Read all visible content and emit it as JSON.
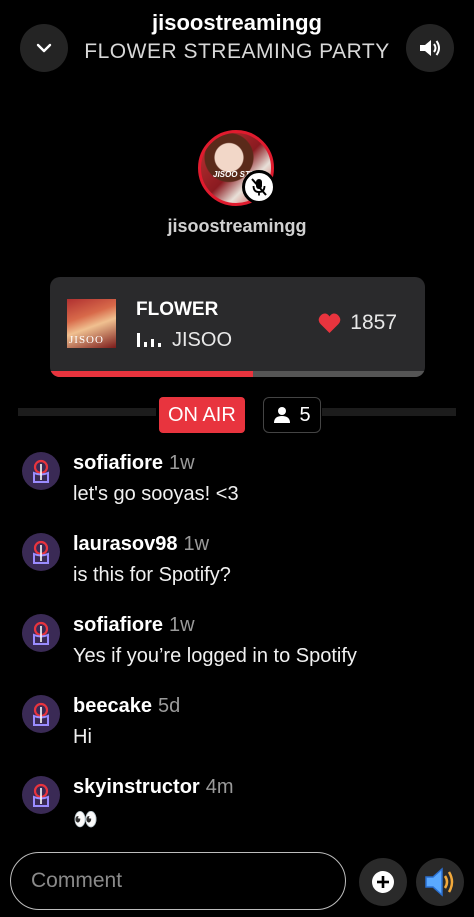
{
  "header": {
    "title": "jisoostreamingg",
    "subtitle": "FLOWER STREAMING PARTY"
  },
  "host": {
    "name": "jisoostreamingg",
    "avatar_text": "JISOO STREA"
  },
  "now_playing": {
    "album_art_text": "JISOO",
    "title": "FLOWER",
    "artist": "JISOO",
    "likes": "1857",
    "progress": 0.54
  },
  "status": {
    "on_air_label": "ON AIR",
    "listener_count": "5"
  },
  "comments": [
    {
      "user": "sofiafiore",
      "time": "1w",
      "text": "let's go sooyas! <3"
    },
    {
      "user": "laurasov98",
      "time": "1w",
      "text": "is this for Spotify?"
    },
    {
      "user": "sofiafiore",
      "time": "1w",
      "text": "Yes if you’re logged in to Spotify"
    },
    {
      "user": "beecake",
      "time": "5d",
      "text": "Hi"
    },
    {
      "user": "skyinstructor",
      "time": "4m",
      "text": "👀"
    }
  ],
  "composer": {
    "placeholder": "Comment"
  },
  "colors": {
    "accent": "#e8343e",
    "background": "#000000",
    "card": "#2a2a2c"
  },
  "icons": [
    "chevron-down-icon",
    "volume-icon",
    "mic-off-icon",
    "equalizer-icon",
    "heart-icon",
    "person-icon",
    "user-avatar-icon",
    "plus-icon",
    "speaker-icon"
  ]
}
